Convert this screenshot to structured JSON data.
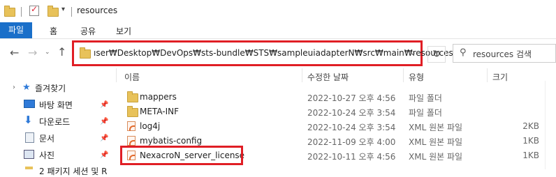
{
  "title": "resources",
  "ribbon": {
    "file": "파일",
    "home": "홈",
    "share": "공유",
    "view": "보기"
  },
  "address": {
    "path": "ıser₩Desktop₩DevOps₩sts-bundle₩STS₩sampleuiadapterN₩src₩main₩resources"
  },
  "search": {
    "placeholder": "resources 검색"
  },
  "sidebar": [
    {
      "label": "즐겨찾기"
    },
    {
      "label": "바탕 화면"
    },
    {
      "label": "다운로드"
    },
    {
      "label": "문서"
    },
    {
      "label": "사진"
    },
    {
      "label": "2 패키지 세션 및 R"
    }
  ],
  "columns": {
    "name": "이름",
    "date": "수정한 날짜",
    "type": "유형",
    "size": "크기"
  },
  "files": [
    {
      "name": "mappers",
      "date": "2022-10-27 오후 4:56",
      "type": "파일 폴더",
      "size": "",
      "kind": "folder"
    },
    {
      "name": "META-INF",
      "date": "2022-10-24 오후 3:54",
      "type": "파일 폴더",
      "size": "",
      "kind": "folder"
    },
    {
      "name": "log4j",
      "date": "2022-10-24 오후 3:54",
      "type": "XML 원본 파일",
      "size": "2KB",
      "kind": "xml"
    },
    {
      "name": "mybatis-config",
      "date": "2022-11-09 오후 4:00",
      "type": "XML 원본 파일",
      "size": "1KB",
      "kind": "xml"
    },
    {
      "name": "NexacroN_server_license",
      "date": "2022-10-11 오후 4:56",
      "type": "XML 원본 파일",
      "size": "1KB",
      "kind": "xml"
    }
  ],
  "colors": {
    "accent": "#1a6fc9",
    "highlight": "#e01e25",
    "folder": "#e8c25a"
  }
}
